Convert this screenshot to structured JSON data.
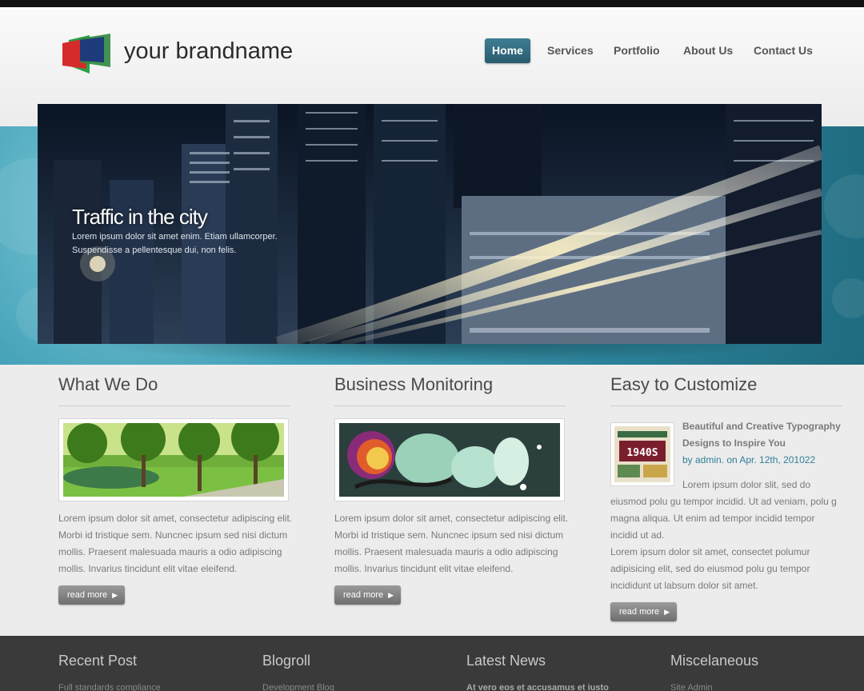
{
  "header": {
    "brand_name": "your brandname",
    "nav": [
      {
        "label": "Home",
        "active": true
      },
      {
        "label": "Services",
        "active": false
      },
      {
        "label": "Portfolio",
        "active": false
      },
      {
        "label": "About Us",
        "active": false
      },
      {
        "label": "Contact Us",
        "active": false
      }
    ]
  },
  "hero": {
    "title": "Traffic in the city",
    "line1": "Lorem ipsum dolor sit amet enim. Etiam ullamcorper.",
    "line2": "Suspendisse a pellentesque dui, non felis."
  },
  "columns": [
    {
      "title": "What We Do",
      "image": "park-trees-lake",
      "text": "Lorem ipsum dolor sit amet, consectetur adipiscing elit. Morbi id tristique sem. Nuncnec ipsum sed nisi dictum mollis. Praesent malesuada mauris a odio adipiscing mollis. Invarius tincidunt elit vitae eleifend.",
      "button": "read more"
    },
    {
      "title": "Business Monitoring",
      "image": "abstract-swirl-art",
      "text": "Lorem ipsum dolor sit amet, consectetur adipiscing elit. Morbi id tristique sem. Nuncnec ipsum sed nisi dictum mollis. Praesent malesuada mauris a odio adipiscing mollis. Invarius tincidunt elit vitae eleifend.",
      "button": "read more"
    },
    {
      "title": "Easy to Customize",
      "image": "typography-1940s",
      "post_title": "Beautiful and Creative Typography Designs to Inspire You",
      "post_meta": "by admin. on Apr. 12th, 201022",
      "text": "Lorem ipsum dolor slit, sed do eiusmod polu gu tempor incidid. Ut ad veniam, polu g magna aliqua. Ut enim ad tempor incidid tempor incidid ut ad.",
      "text2": "Lorem ipsum dolor sit amet, consectet polumur adipisicing elit, sed do eiusmod polu gu tempor incididunt ut labsum dolor sit amet.",
      "button": "read more"
    }
  ],
  "footer": [
    {
      "title": "Recent Post",
      "first_item": "Full standards compliance"
    },
    {
      "title": "Blogroll",
      "first_item": "Development Blog"
    },
    {
      "title": "Latest News",
      "first_item": "At vero eos et accusamus et iusto"
    },
    {
      "title": "Miscelaneous",
      "first_item": "Site Admin"
    }
  ],
  "colors": {
    "accent": "#2f7f99",
    "nav_active": "#2f6a7e",
    "teal_band": "#3e9db4",
    "footer_bg": "#3a3a3a"
  }
}
